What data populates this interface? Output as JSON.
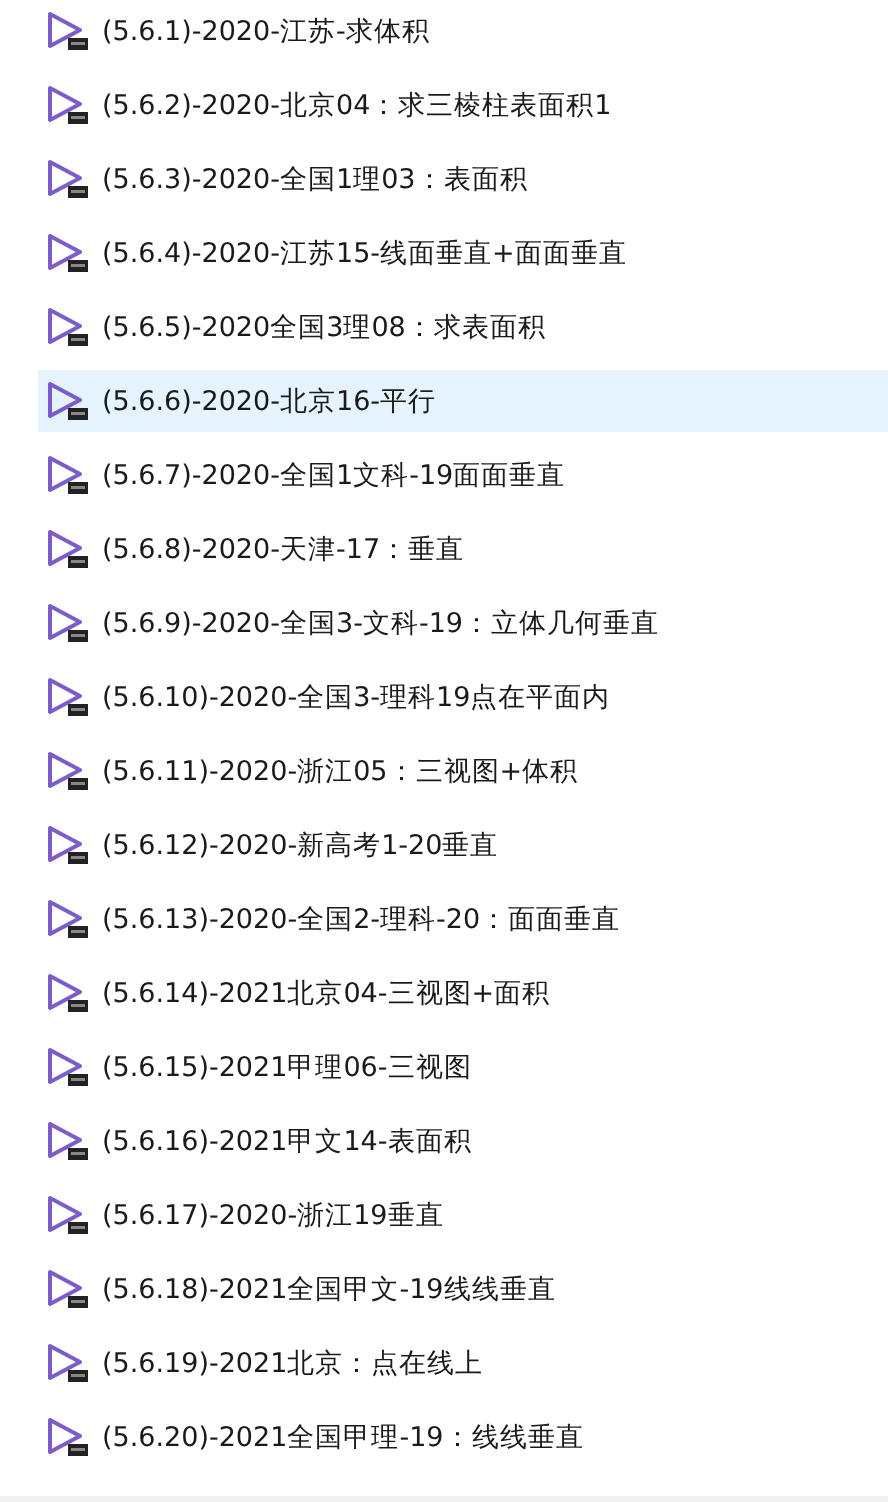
{
  "files": [
    {
      "name": "(5.6.1)-2020-江苏-求体积",
      "selected": false
    },
    {
      "name": "(5.6.2)-2020-北京04：求三棱柱表面积1",
      "selected": false
    },
    {
      "name": "(5.6.3)-2020-全国1理03：表面积",
      "selected": false
    },
    {
      "name": "(5.6.4)-2020-江苏15-线面垂直+面面垂直",
      "selected": false
    },
    {
      "name": "(5.6.5)-2020全国3理08：求表面积",
      "selected": false
    },
    {
      "name": "(5.6.6)-2020-北京16-平行",
      "selected": true
    },
    {
      "name": "(5.6.7)-2020-全国1文科-19面面垂直",
      "selected": false
    },
    {
      "name": "(5.6.8)-2020-天津-17：垂直",
      "selected": false
    },
    {
      "name": "(5.6.9)-2020-全国3-文科-19：立体几何垂直",
      "selected": false
    },
    {
      "name": "(5.6.10)-2020-全国3-理科19点在平面内",
      "selected": false
    },
    {
      "name": "(5.6.11)-2020-浙江05：三视图+体积",
      "selected": false
    },
    {
      "name": "(5.6.12)-2020-新高考1-20垂直",
      "selected": false
    },
    {
      "name": "(5.6.13)-2020-全国2-理科-20：面面垂直",
      "selected": false
    },
    {
      "name": "(5.6.14)-2021北京04-三视图+面积",
      "selected": false
    },
    {
      "name": "(5.6.15)-2021甲理06-三视图",
      "selected": false
    },
    {
      "name": "(5.6.16)-2021甲文14-表面积",
      "selected": false
    },
    {
      "name": "(5.6.17)-2020-浙江19垂直",
      "selected": false
    },
    {
      "name": "(5.6.18)-2021全国甲文-19线线垂直",
      "selected": false
    },
    {
      "name": "(5.6.19)-2021北京：点在线上",
      "selected": false
    },
    {
      "name": "(5.6.20)-2021全国甲理-19：线线垂直",
      "selected": false
    }
  ]
}
